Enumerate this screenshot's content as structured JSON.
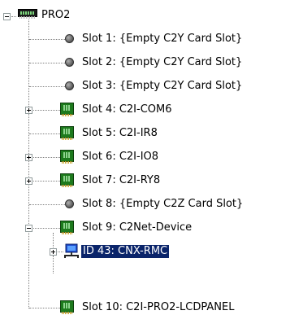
{
  "tree": {
    "root": {
      "label": "PRO2",
      "icon": "control-processor-icon",
      "expanded": true
    },
    "slots": [
      {
        "label": "Slot 1: {Empty C2Y Card Slot}",
        "icon": "empty-slot-icon",
        "expander": "none"
      },
      {
        "label": "Slot 2: {Empty C2Y Card Slot}",
        "icon": "empty-slot-icon",
        "expander": "none"
      },
      {
        "label": "Slot 3: {Empty C2Y Card Slot}",
        "icon": "empty-slot-icon",
        "expander": "none"
      },
      {
        "label": "Slot 4: C2I-COM6",
        "icon": "card-icon",
        "expander": "plus"
      },
      {
        "label": "Slot 5: C2I-IR8",
        "icon": "card-icon",
        "expander": "none"
      },
      {
        "label": "Slot 6: C2I-IO8",
        "icon": "card-icon",
        "expander": "plus"
      },
      {
        "label": "Slot 7: C2I-RY8",
        "icon": "card-icon",
        "expander": "plus"
      },
      {
        "label": "Slot 8: {Empty C2Z Card Slot}",
        "icon": "empty-slot-icon",
        "expander": "none"
      },
      {
        "label": "Slot 9: C2Net-Device",
        "icon": "card-icon",
        "expander": "minus"
      },
      {
        "label": "Slot 10: C2I-PRO2-LCDPANEL",
        "icon": "card-icon",
        "expander": "none"
      }
    ],
    "child": {
      "label": "ID 43: CNX-RMC",
      "icon": "network-device-icon",
      "expander": "plus",
      "selected": true
    }
  },
  "colors": {
    "selection_bg": "#0a246a",
    "selection_fg": "#ffffff",
    "card_green": "#1d7a1d"
  }
}
